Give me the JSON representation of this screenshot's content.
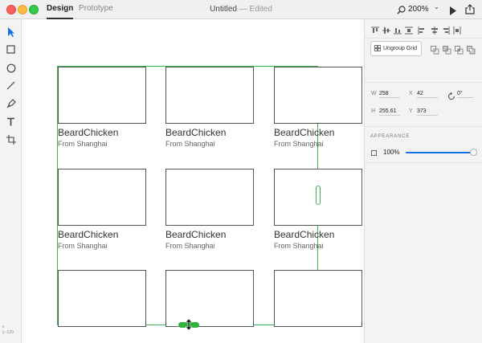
{
  "titlebar": {
    "tab_design": "Design",
    "tab_prototype": "Prototype",
    "doc_name": "Untitled",
    "doc_status": " — Edited",
    "zoom": "200%",
    "zoom_chevron": "⌄"
  },
  "grid": {
    "name": "BeardChicken",
    "location": "From Shanghai"
  },
  "toolbar": {
    "coords_line1": "x",
    "coords_line2": "y  -120"
  },
  "inspector": {
    "ungroup_label": "Ungroup Grid",
    "w_label": "W",
    "w_value": "258",
    "x_label": "X",
    "x_value": "42",
    "rotation": "0°",
    "h_label": "H",
    "h_value": "255.61",
    "y_label": "Y",
    "y_value": "373",
    "appearance_title": "APPEARANCE",
    "opacity": "100%",
    "opacity_fraction": 1.0
  },
  "colors": {
    "selection": "#3fb34f",
    "accent": "#1473e6"
  }
}
